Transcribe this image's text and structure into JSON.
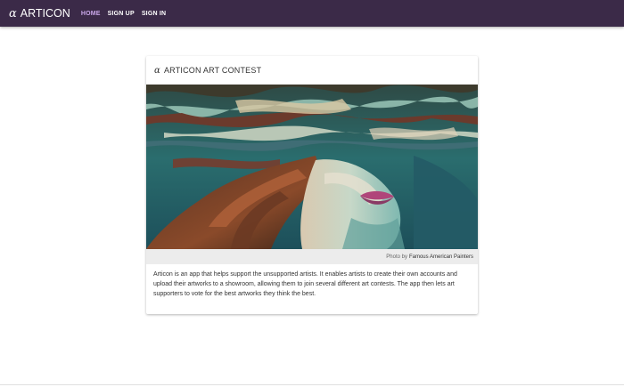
{
  "navbar": {
    "brand_symbol": "α",
    "brand_name": "ARTICON",
    "links": [
      {
        "label": "HOME",
        "active": true
      },
      {
        "label": "SIGN UP",
        "active": false
      },
      {
        "label": "SIGN IN",
        "active": false
      }
    ],
    "background_color": "#3b2a48",
    "active_color": "#c8a6e8"
  },
  "card": {
    "title_symbol": "α",
    "title": "ARTICON ART CONTEST",
    "image_icon": "painting-woman-underwater",
    "caption_prefix": "Photo by",
    "caption_link": "Famous American Painters",
    "description": "Articon is an app that helps support the unsupported artists. It enables artists to create their own accounts and upload their artworks to a showroom, allowing them to join several different art contests. The app then lets art supporters to vote for the best artworks they think the best."
  }
}
